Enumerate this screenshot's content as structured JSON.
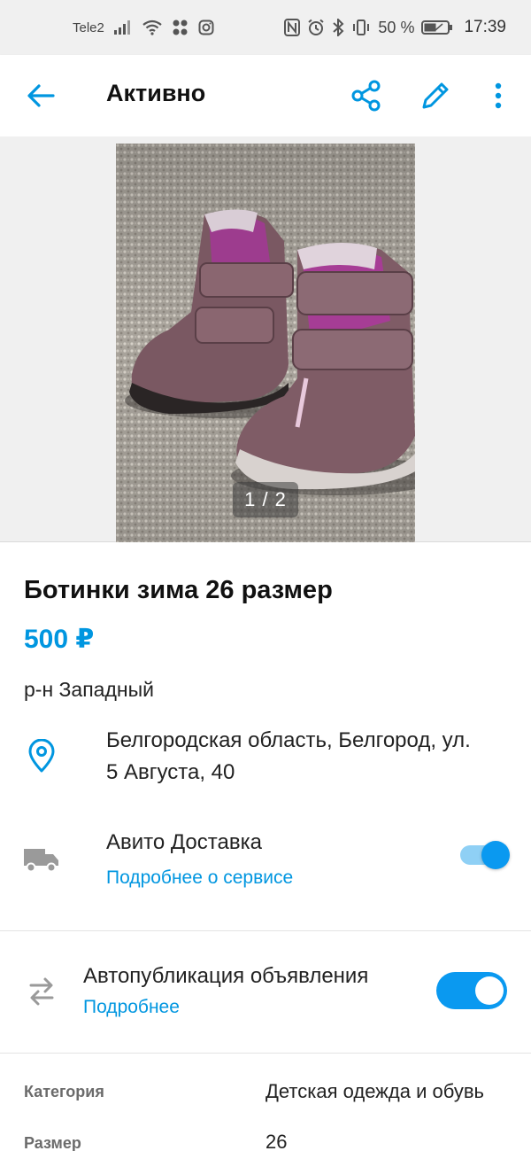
{
  "status_bar": {
    "carrier": "Tele2",
    "battery": "50 %",
    "time": "17:39"
  },
  "app_bar": {
    "title": "Активно"
  },
  "gallery": {
    "counter": "1 / 2"
  },
  "listing": {
    "title": "Ботинки зима 26 размер",
    "price": "500 ₽",
    "district": "р-н Западный",
    "address_line1": "Белгородская область, Белгород, ул.",
    "address_line2": "5 Августа, 40"
  },
  "delivery": {
    "title": "Авито Доставка",
    "link": "Подробнее о сервисе",
    "enabled": true
  },
  "autopublish": {
    "title": "Автопубликация объявления",
    "link": "Подробнее",
    "enabled": true
  },
  "params": [
    {
      "label": "Категория",
      "value": "Детская одежда и обувь"
    },
    {
      "label": "Размер",
      "value": "26"
    }
  ],
  "colors": {
    "accent": "#0096e0",
    "toggle_on": "#0a99f0"
  }
}
